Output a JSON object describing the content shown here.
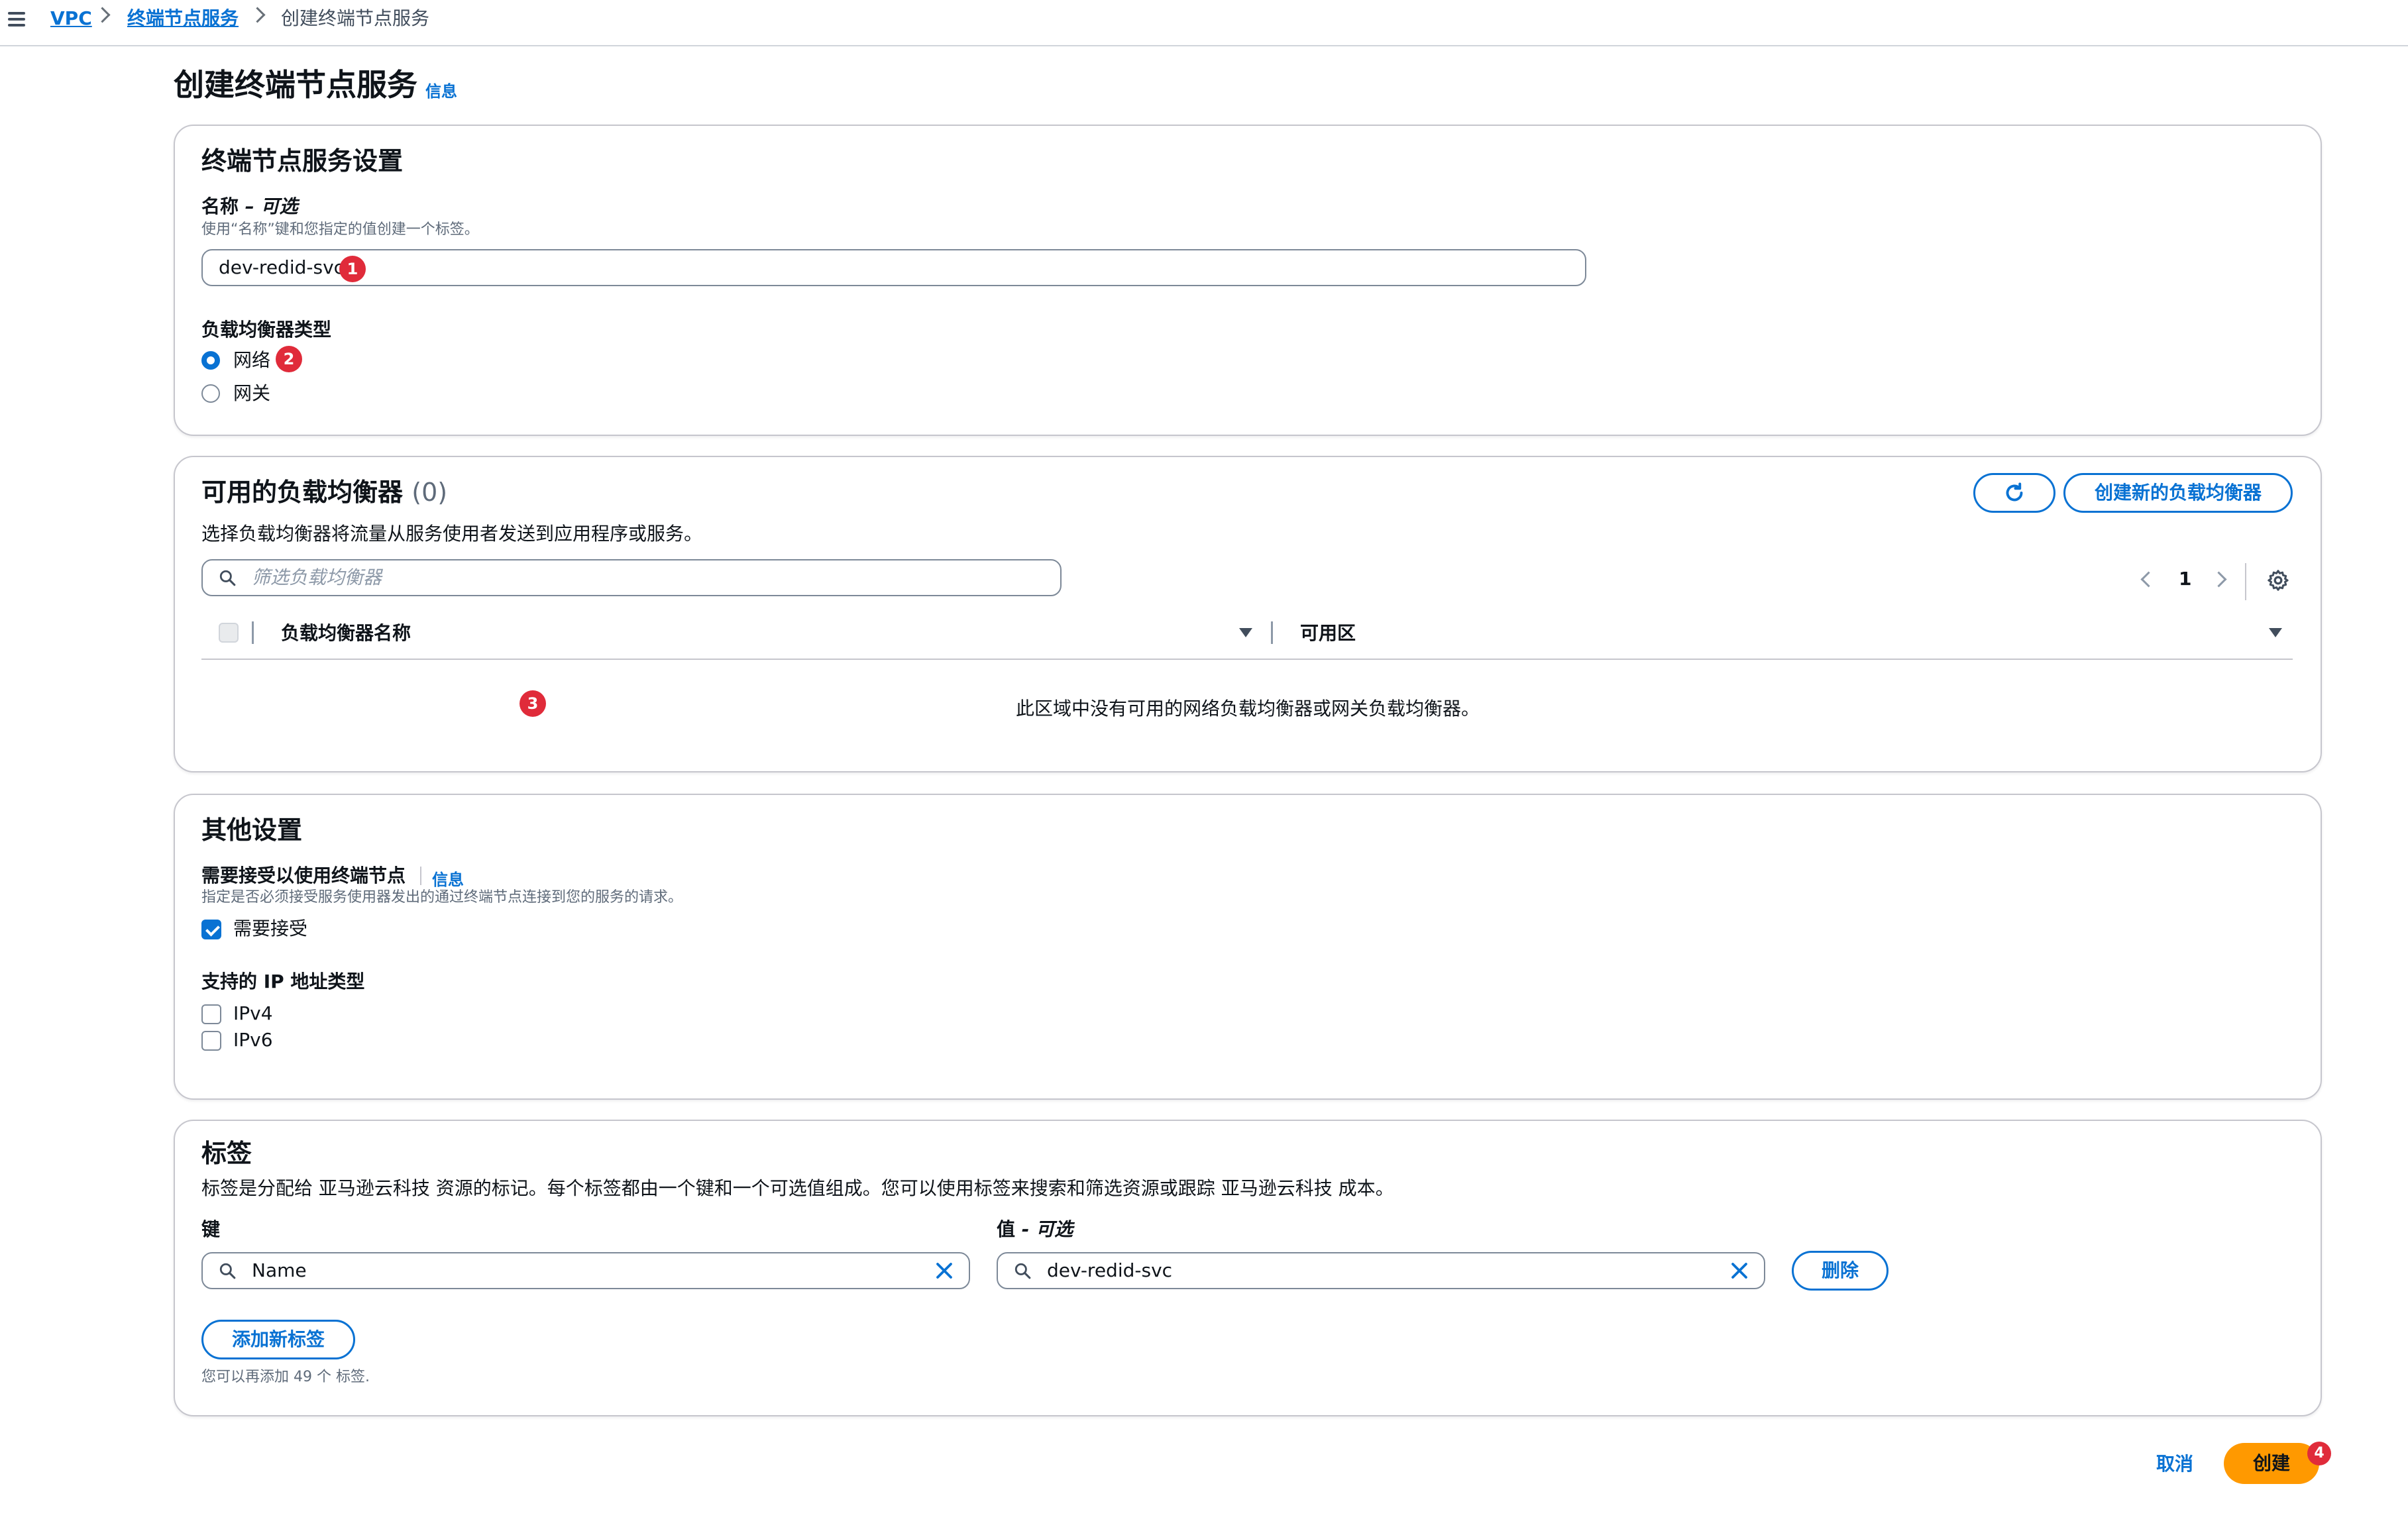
{
  "breadcrumb": {
    "items": [
      "VPC",
      "终端节点服务",
      "创建终端节点服务"
    ]
  },
  "page": {
    "title": "创建终端节点服务",
    "info_link": "信息"
  },
  "settings_panel": {
    "title": "终端节点服务设置",
    "name_label": "名称",
    "name_optional": "– 可选",
    "name_description": "使用“名称”键和您指定的值创建一个标签。",
    "name_value": "dev-redid-svc",
    "lb_type_label": "负载均衡器类型",
    "lb_type_options": [
      "网络",
      "网关"
    ],
    "lb_type_selected": "网络"
  },
  "lb_panel": {
    "title": "可用的负载均衡器",
    "count": "(0)",
    "description": "选择负载均衡器将流量从服务使用者发送到应用程序或服务。",
    "filter_placeholder": "筛选负载均衡器",
    "create_button": "创建新的负载均衡器",
    "page_number": "1",
    "columns": [
      "负载均衡器名称",
      "可用区"
    ],
    "empty_message": "此区域中没有可用的网络负载均衡器或网关负载均衡器。"
  },
  "other_panel": {
    "title": "其他设置",
    "acceptance_label": "需要接受以使用终端节点",
    "acceptance_info": "信息",
    "acceptance_description": "指定是否必须接受服务使用器发出的通过终端节点连接到您的服务的请求。",
    "acceptance_checkbox": "需要接受",
    "acceptance_checked": true,
    "ip_type_label": "支持的 IP 地址类型",
    "ip_options": [
      "IPv4",
      "IPv6"
    ]
  },
  "tags_panel": {
    "title": "标签",
    "description": "标签是分配给 亚马逊云科技 资源的标记。每个标签都由一个键和一个可选值组成。您可以使用标签来搜索和筛选资源或跟踪 亚马逊云科技 成本。",
    "key_label": "键",
    "value_label": "值",
    "value_optional": "- 可选",
    "key_value": "Name",
    "value_value": "dev-redid-svc",
    "remove_button": "删除",
    "add_button": "添加新标签",
    "remaining_note": "您可以再添加 49 个 标签."
  },
  "footer": {
    "cancel_button": "取消",
    "create_button": "创建"
  },
  "annotations": [
    "1",
    "2",
    "3",
    "4"
  ],
  "colors": {
    "accent": "#0972d3",
    "primary_button": "#ff9900",
    "badge": "#e02b3a",
    "border": "#c6c6cd"
  },
  "icons": [
    "menu-icon",
    "chevron-right-icon",
    "refresh-icon",
    "search-icon",
    "settings-icon",
    "clear-icon",
    "sort-icon"
  ]
}
